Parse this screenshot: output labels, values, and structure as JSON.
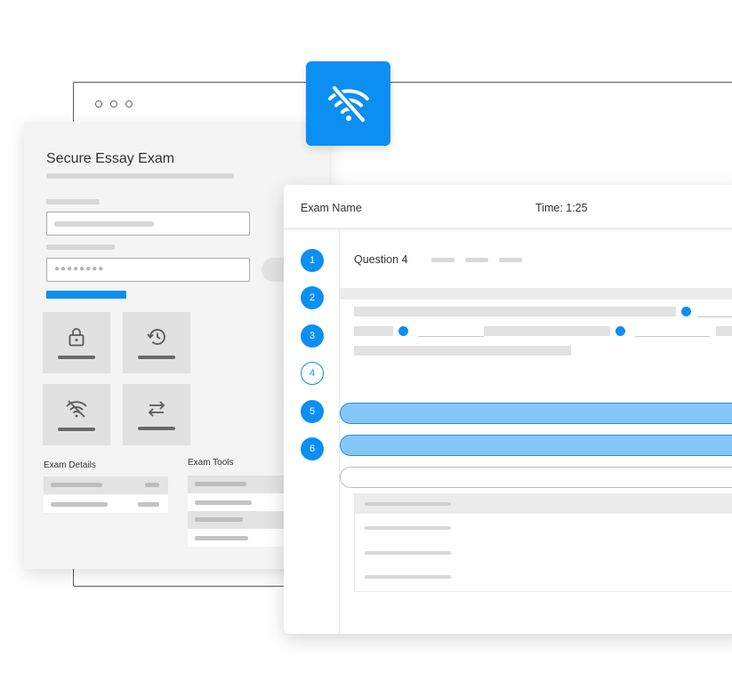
{
  "exam_panel": {
    "title": "Secure Essay Exam",
    "password_mask": "●●●●●●●●",
    "tiles": [
      {
        "icon": "lock-icon"
      },
      {
        "icon": "history-icon"
      },
      {
        "icon": "wifi-off-icon"
      },
      {
        "icon": "swap-arrows-icon"
      }
    ],
    "exam_details_label": "Exam Details",
    "exam_tools_label": "Exam Tools"
  },
  "badge": {
    "icon": "wifi-off-icon",
    "color": "#0b8ff3"
  },
  "question_window": {
    "exam_name": "Exam Name",
    "timer": "Time: 1:25",
    "question_title": "Question 4",
    "question_numbers": [
      "1",
      "2",
      "3",
      "4",
      "5",
      "6"
    ],
    "current_question": "4",
    "selected_options": [
      "5",
      "6"
    ]
  },
  "colors": {
    "accent": "#0b8ff3",
    "option_selected": "#86c7f8"
  }
}
